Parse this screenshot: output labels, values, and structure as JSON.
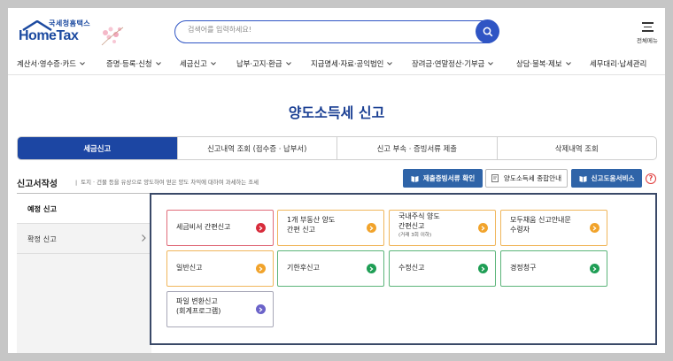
{
  "header": {
    "logo_small": "국세청홈택스",
    "logo_big": "HomeTax",
    "search_placeholder": "검색어를 입력하세요!",
    "menu_label": "전체메뉴"
  },
  "nav": [
    "계산서·영수증·카드",
    "증명·등록·신청",
    "세금신고",
    "납부·고지·환급",
    "지급명세·자료·공익법인",
    "장려금·연말정산·기부금",
    "상담·불복·제보",
    "세무대리·납세관리"
  ],
  "page_title": "양도소득세 신고",
  "tabs": [
    "세금신고",
    "신고내역 조회 (접수증 · 납부서)",
    "신고 부속 · 증빙서류 제출",
    "삭제내역 조회"
  ],
  "section": {
    "title": "신고서작성",
    "desc": "토지 · 건물 등을 유상으로 양도하여 얻은 양도 차익에 대하여 과세하는 조세",
    "buttons": [
      "제출증빙서류 확인",
      "양도소득세 종합안내",
      "신고도움서비스"
    ],
    "help": "?"
  },
  "side_menu": [
    "예정 신고",
    "확정 신고"
  ],
  "cards": [
    {
      "title": "세금비서 간편신고",
      "color": "red"
    },
    {
      "title": "1개 부동산 양도 간편 신고",
      "line1": "1개 부동산 양도",
      "line2": "간편 신고",
      "color": "orange"
    },
    {
      "line1": "국내주식 양도",
      "line2": "간편신고",
      "sub": "(거래 3회 이하)",
      "color": "orange"
    },
    {
      "line1": "모두채움 신고안내문",
      "line2": "수령자",
      "color": "orange"
    },
    {
      "title": "일반신고",
      "color": "orange"
    },
    {
      "title": "기한후신고",
      "color": "green"
    },
    {
      "title": "수정신고",
      "color": "green"
    },
    {
      "title": "경정청구",
      "color": "green"
    },
    {
      "line1": "파일 변환신고",
      "line2": "(회계프로그램)",
      "color": "purple"
    }
  ]
}
